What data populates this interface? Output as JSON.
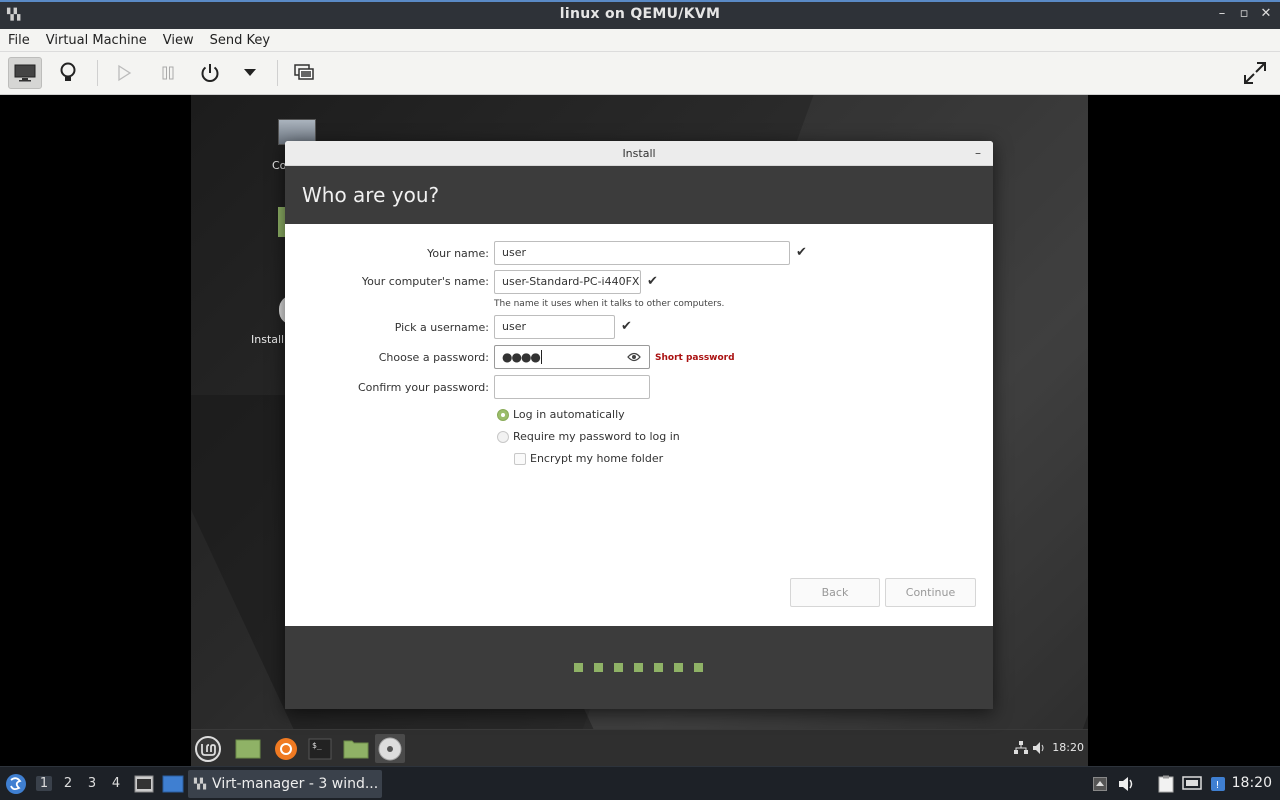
{
  "window": {
    "title": "linux on QEMU/KVM"
  },
  "menubar": {
    "items": [
      "File",
      "Virtual Machine",
      "View",
      "Send Key"
    ]
  },
  "toolbar": {
    "buttons": [
      "console-icon",
      "details-bulb-icon",
      "run-icon",
      "pause-icon",
      "power-icon",
      "power-menu-chevron",
      "snapshots-icon",
      "fullscreen-icon"
    ]
  },
  "desktop": {
    "icons": [
      {
        "label": "Co"
      },
      {
        "label": "Install"
      }
    ]
  },
  "installer": {
    "window_title": "Install",
    "minimize_label": "–",
    "heading": "Who are you?",
    "fields": {
      "name_label": "Your name:",
      "name_value": "user",
      "computer_label": "Your computer's name:",
      "computer_value": "user-Standard-PC-i440FX",
      "computer_hint": "The name it uses when it talks to other computers.",
      "username_label": "Pick a username:",
      "username_value": "user",
      "password_label": "Choose a password:",
      "password_value": "●●●●",
      "password_warning": "Short password",
      "confirm_label": "Confirm your password:",
      "confirm_value": ""
    },
    "checkmark": "✔",
    "options": {
      "auto_login": "Log in automatically",
      "require_password": "Require my password to log in",
      "encrypt_home": "Encrypt my home folder"
    },
    "selected_option": "auto_login",
    "buttons": {
      "back": "Back",
      "continue": "Continue"
    },
    "progress": {
      "steps": 7
    }
  },
  "guest_panel": {
    "clock": "18:20"
  },
  "taskbar": {
    "workspaces": [
      "1",
      "2",
      "3",
      "4"
    ],
    "active_workspace": "1",
    "task_label": "Virt-manager - 3 wind...",
    "clock": "18:20"
  },
  "colors": {
    "accent_green": "#8fb266",
    "header_dark": "#3c3c3c",
    "warning_red": "#aa1111"
  }
}
